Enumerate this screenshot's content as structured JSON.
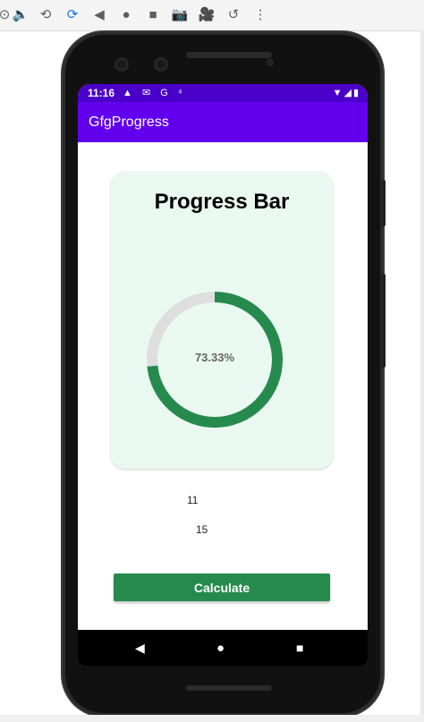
{
  "toolbar": {
    "icons": [
      "power-icon",
      "volume-icon",
      "rotate-left-icon",
      "rotate-right-icon",
      "back-icon",
      "home-icon",
      "overview-icon",
      "camera-icon",
      "video-icon",
      "history-icon",
      "more-icon"
    ]
  },
  "status_bar": {
    "time": "11:16",
    "left_icons": "▲ ✉ G ⁴",
    "right_icons": "▼◢▮"
  },
  "app_bar": {
    "title": "GfgProgress"
  },
  "card": {
    "title": "Progress Bar",
    "progress_fraction": 0.7333,
    "progress_label": "73.33%",
    "progress_color": "#268a4d",
    "track_color": "#dedede",
    "background_color": "#eaf8f2"
  },
  "inputs": {
    "value1": "11",
    "value2": "15"
  },
  "button": {
    "label": "Calculate",
    "color": "#268a4d"
  },
  "colors": {
    "status_bar": "#4a00c9",
    "app_bar": "#6200ee"
  }
}
